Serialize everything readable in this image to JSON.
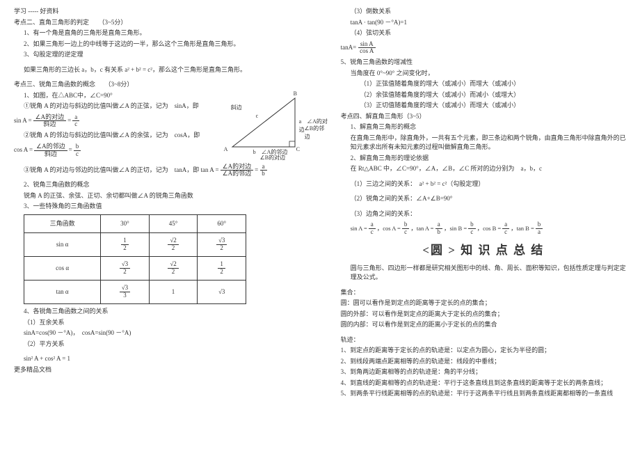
{
  "left": {
    "header": "学习 ----- 好资料",
    "k2_title": "考点二、直角三角形的判定　　（3~5分）",
    "k2_1": "1、有一个角是直角的三角形是直角三角形。",
    "k2_2": "2、如果三角形一边上的中线等于这边的一半，那么这个三角形是直角三角形。",
    "k2_3": "3、勾股定理的逆定理",
    "k2_3b": "如果三角形的三边长 a，b，c 有关系 a² + b² = c²，那么这个三角形是直角三角形。",
    "k3_title": "考点三、锐角三角函数的概念　　（3~8分）",
    "k3_img": "1、如图，在△ABC中，∠C=90°",
    "k3_1": "①锐角 A 的对边与斜边的比值叫做∠A 的正弦，记为　sinA，即",
    "sinA_frac1_num": "∠A的对边",
    "sinA_frac1_den": "斜边",
    "sinA_frac2_num": "a",
    "sinA_frac2_den": "c",
    "k3_2": "②锐角 A 的邻边与斜边的比值叫做∠A 的余弦，记为　cosA，即",
    "cosA_frac1_num": "∠A的邻边",
    "cosA_frac1_den": "斜边",
    "cosA_frac2_num": "b",
    "cosA_frac2_den": "c",
    "k3_3": "③锐角 A 的对边与邻边的比值叫做∠A 的正切，记为　tanA，即 tan A =",
    "tanA_frac1_num": "∠A的对边",
    "tanA_frac1_den": "∠A的邻边",
    "tanA_frac2_num": "a",
    "tanA_frac2_den": "b",
    "k3_4t": "2、锐角三角函数的概念",
    "k3_4": "锐角 A 的正弦、余弦、正切、余切都叫做∠A 的锐角三角函数",
    "k3_5t": "3、一些特殊角的三角函数值",
    "table": {
      "h1": "三角函数",
      "h2": "30°",
      "h3": "45°",
      "h4": "60°",
      "r1": "sin α",
      "r2": "cos α",
      "r3": "tan α"
    },
    "k3_6t": "4、各锐角三角函数之间的关系",
    "k3_6a": "（1）互余关系",
    "k3_6b": "sinA=cos(90 －°A)，　cosA=sin(90 －°A)",
    "k3_6c": "（2）平方关系",
    "k3_6d": "sin² A + cos² A = 1",
    "footer": "更多精品文档",
    "tri": {
      "B": "B",
      "A": "A",
      "C": "C",
      "c": "c",
      "a1": "a",
      "a2": "∠A的对边",
      "a3": "∠B的邻边",
      "b1": "b",
      "b2": "∠A的邻边",
      "b3": "∠B的对边",
      "hyp": "斜边"
    }
  },
  "right": {
    "r1": "（3）倒数关系",
    "r2": "tanA · tan(90 －°A)=1",
    "r3": "（4）弦切关系",
    "r4_lhs": "tanA=",
    "r4_num": "sin A",
    "r4_den": "cos A",
    "r5t": "5、锐角三角函数的增减性",
    "r5a": "当角度在 0°~90° 之间变化时，",
    "r5b": "（1）正弦值随着角度的增大（或减小）而增大（或减小）",
    "r5c": "（2）余弦值随着角度的增大（或减小）而减小（或增大）",
    "r5d": "（3）正切值随着角度的增大（或减小）而增大（或减小）",
    "k4_title": "考点四、解直角三角形（3~5）",
    "k4_1t": "1、解直角三角形的概念",
    "k4_1a": "在直角三角形中，除直角外，一共有五个元素，即三条边和两个锐角，由直角三角形中除直角外的已知元素求出所有未知元素的过程叫做解直角三角形。",
    "k4_2t": "2、解直角三角形的理论依据",
    "k4_2a": "在 Rt△ABC 中，∠C=90°，∠A，∠B，∠C 所对的边分别为　a，b，c",
    "k4_3a": "（1）三边之间的关系：　a² + b² = c²（勾股定理）",
    "k4_3b": "（2）锐角之间的关系：∠A+∠B=90°",
    "k4_3c": "（3）边角之间的关系：",
    "k4_3d_pre": "sin A =",
    "ac_num": "a",
    "ac_den": "c",
    "bc_num": "b",
    "bc_den": "c",
    "ab_num": "a",
    "ab_den": "b",
    "ba_num": "b",
    "ba_den": "a",
    "cos": "，cos A =",
    "tan": "，tan A =",
    "sinB": "，sin B =",
    "cosB": "，cos B =",
    "tanB": "，tan B =",
    "circle_title": "<圆 > 知 识 点 总 结",
    "c1": "圆与三角形、四边形一样都是研究相关图形中的线、角、周长、面积等知识，包括性质定理与判定定理及公式。",
    "c2t": "集合：",
    "c2a": "圆：圆可以看作是到定点的距离等于定长的点的集合；",
    "c2b": "圆的外部：可以看作是到定点的距离大于定长的点的集合；",
    "c2c": "圆的内部：可以看作是到定点的距离小于定长的点的集合",
    "c3t": "轨迹：",
    "c3a": "1、到定点的距离等于定长的点的轨迹是：以定点为圆心，定长为半径的圆；",
    "c3b": "2、到线段两端点距离相等的点的轨迹是：线段的中垂线；",
    "c3c": "3、到角两边距离相等的点的轨迹是：角的平分线；",
    "c3d": "4、到直线的距离相等的点的轨迹是：平行于这条直线且到这条直线的距离等于定长的两条直线；",
    "c3e": "5、到两条平行线距离相等的点的轨迹是：平行于这两条平行线且到两条直线距离都相等的一条直线"
  }
}
